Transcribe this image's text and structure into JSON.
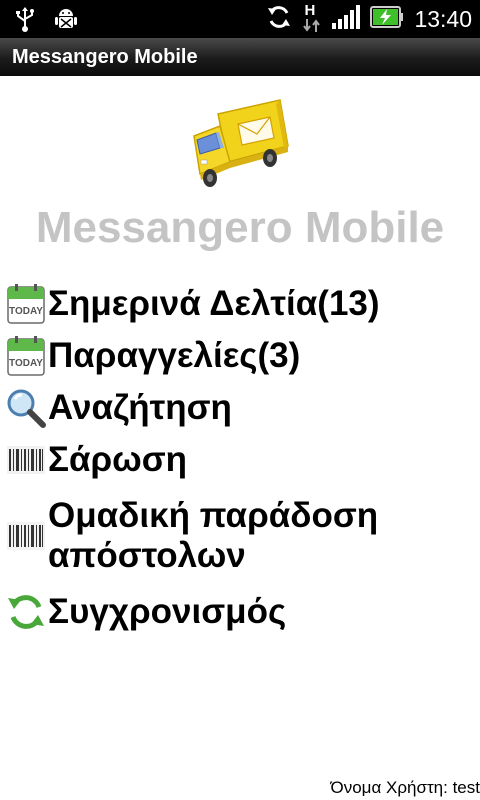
{
  "status_bar": {
    "time": "13:40",
    "network_label": "H",
    "icons": [
      "usb-icon",
      "android-debug-icon",
      "sync-icon",
      "network-h-icon",
      "signal-icon",
      "battery-charging-icon"
    ]
  },
  "app_bar": {
    "title": "Messangero Mobile"
  },
  "brand": {
    "title": "Messangero Mobile"
  },
  "menu": {
    "items": [
      {
        "label": "Σημερινά Δελτία(13)",
        "icon": "calendar-today-icon"
      },
      {
        "label": "Παραγγελίες(3)",
        "icon": "calendar-today-icon"
      },
      {
        "label": "Αναζήτηση",
        "icon": "magnifier-icon"
      },
      {
        "label": "Σάρωση",
        "icon": "barcode-icon"
      },
      {
        "label": "Ομαδική παράδοση απόστολων",
        "icon": "barcode-icon"
      },
      {
        "label": "Συγχρονισμός",
        "icon": "sync-arrows-icon"
      }
    ]
  },
  "today_badge": "TODAY",
  "footer": {
    "user_label": "Όνομα Χρήστη: test"
  },
  "colors": {
    "status_bg": "#000000",
    "brand_text": "#c4c4c4",
    "battery_green": "#3fbf2a",
    "truck_yellow": "#f2d31c"
  }
}
